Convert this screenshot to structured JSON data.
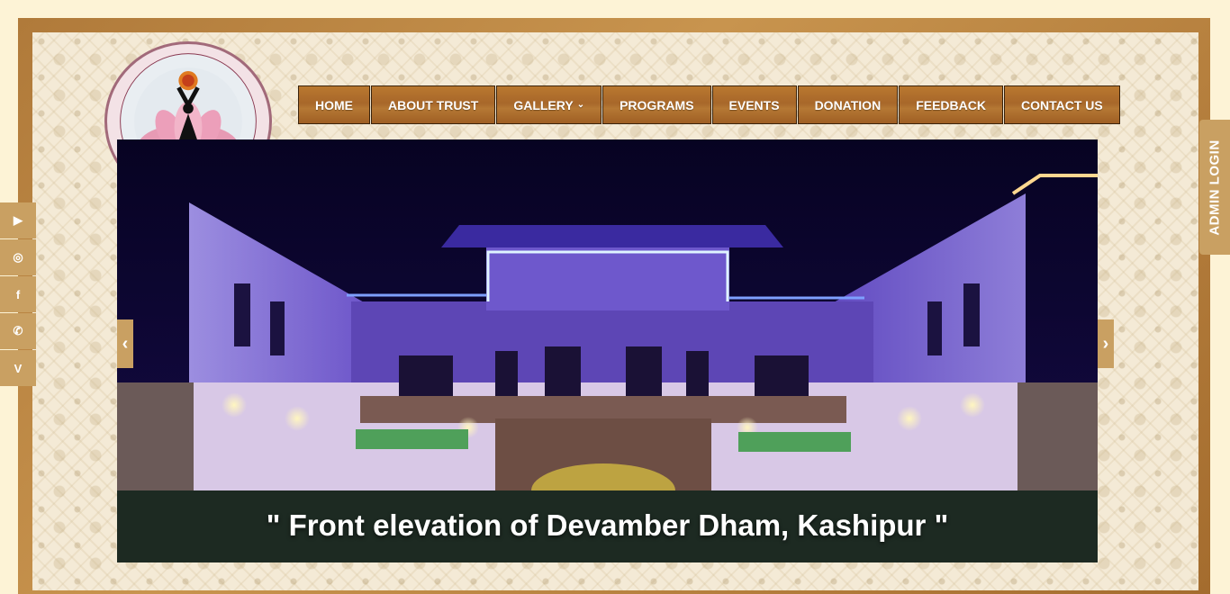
{
  "nav": {
    "items": [
      {
        "label": "HOME"
      },
      {
        "label": "ABOUT TRUST"
      },
      {
        "label": "GALLERY",
        "dropdown": true
      },
      {
        "label": "PROGRAMS"
      },
      {
        "label": "EVENTS"
      },
      {
        "label": "DONATION"
      },
      {
        "label": "FEEDBACK"
      },
      {
        "label": "CONTACT US"
      }
    ]
  },
  "slider": {
    "caption": "\" Front elevation of Devamber Dham, Kashipur \"",
    "prev_label": "‹",
    "next_label": "›"
  },
  "social": {
    "items": [
      {
        "icon": "youtube-icon",
        "glyph": "▶"
      },
      {
        "icon": "instagram-icon",
        "glyph": "◎"
      },
      {
        "icon": "facebook-icon",
        "glyph": "f"
      },
      {
        "icon": "whatsapp-icon",
        "glyph": "✆"
      },
      {
        "icon": "vimeo-icon",
        "glyph": "V"
      }
    ]
  },
  "admin": {
    "label": "ADMIN LOGIN"
  },
  "colors": {
    "nav_bg": "#a8672a",
    "accent": "#c9a062",
    "frame": "#b07a3a"
  }
}
